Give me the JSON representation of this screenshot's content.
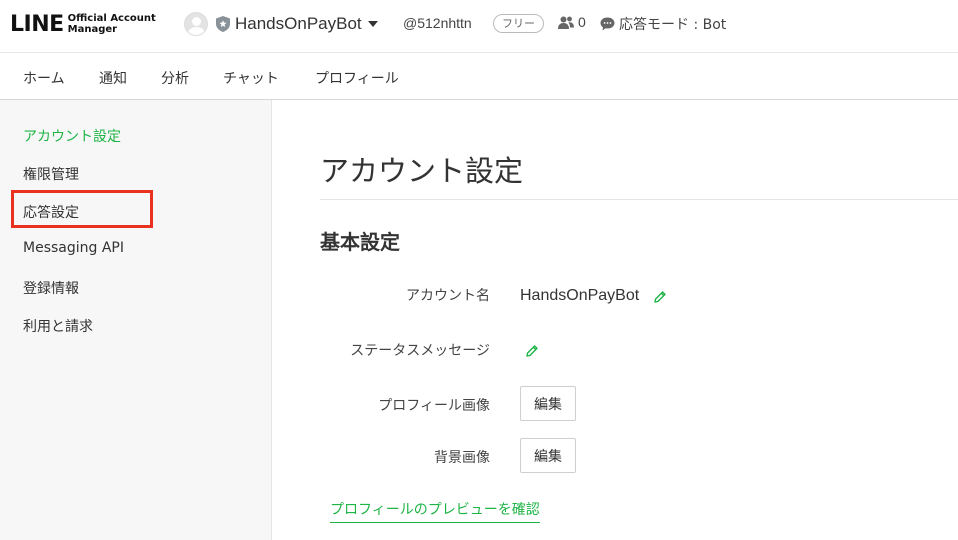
{
  "header": {
    "logo_main": "LINE",
    "logo_sub_1": "Official Account",
    "logo_sub_2": "Manager",
    "account_name": "HandsOnPayBot",
    "account_id": "@512nhttn",
    "plan_badge": "フリー",
    "friend_count": "0",
    "response_mode": "応答モード : Bot",
    "icons": [
      "avatar",
      "shield-icon",
      "caret-down-icon",
      "friends-icon",
      "chat-bubble-icon"
    ]
  },
  "nav": {
    "items": [
      "ホーム",
      "通知",
      "分析",
      "チャット",
      "プロフィール"
    ]
  },
  "sidebar": {
    "items": [
      {
        "label": "アカウント設定",
        "active": true
      },
      {
        "label": "権限管理",
        "active": false
      },
      {
        "label": "応答設定",
        "active": false,
        "highlighted": true
      },
      {
        "label": "Messaging API",
        "active": false
      },
      {
        "label": "登録情報",
        "active": false
      },
      {
        "label": "利用と請求",
        "active": false
      }
    ]
  },
  "main": {
    "title": "アカウント設定",
    "section_title": "基本設定",
    "rows": {
      "account_name_label": "アカウント名",
      "account_name_value": "HandsOnPayBot",
      "status_message_label": "ステータスメッセージ",
      "profile_image_label": "プロフィール画像",
      "background_image_label": "背景画像",
      "edit_label": "編集"
    },
    "preview_link": "プロフィールのプレビューを確認"
  },
  "colors": {
    "accent_green": "#1eb446",
    "highlight_red": "#e8321f"
  }
}
